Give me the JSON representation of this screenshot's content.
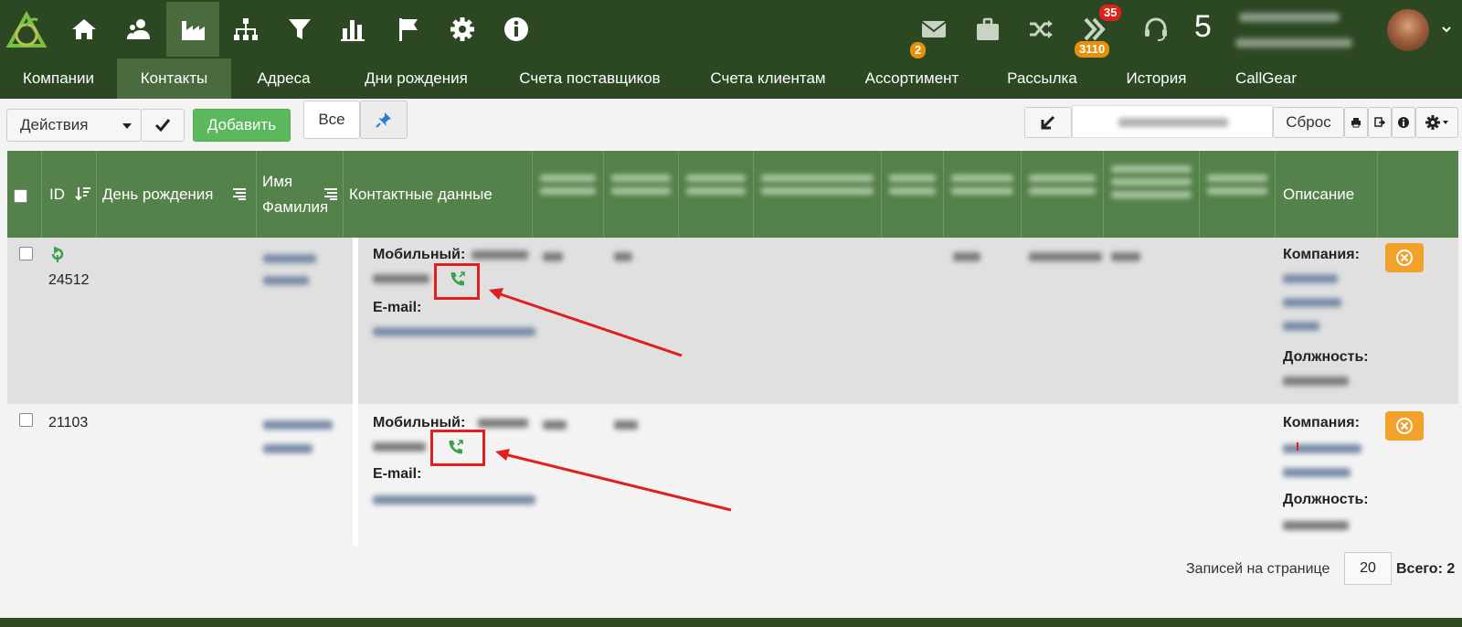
{
  "topbar": {
    "icons": [
      "home-icon",
      "users-icon",
      "factory-icon",
      "org-chart-icon",
      "filter-icon",
      "bar-chart-icon",
      "flag-icon",
      "gear-icon",
      "info-icon"
    ],
    "right_icons": [
      "mail-icon",
      "briefcase-icon",
      "shuffle-icon",
      "chevrons-right-icon",
      "headset-icon"
    ],
    "mail_badge": "2",
    "tasks_badge_red": "35",
    "tasks_badge_orange": "3110",
    "number": "5",
    "colors": {
      "bar": "#2c4823",
      "active": "#4a6b3d",
      "badge_orange": "#e8900c",
      "badge_red": "#d9231b"
    }
  },
  "nav": {
    "items": [
      "Компании",
      "Контакты",
      "Адреса",
      "Дни рождения",
      "Счета поставщиков",
      "Счета клиентам",
      "Ассортимент",
      "Рассылка",
      "История",
      "CallGear"
    ],
    "active": "Контакты"
  },
  "toolbar": {
    "actions_label": "Действия",
    "add_label": "Добавить",
    "all_label": "Все",
    "reset_label": "Сброс"
  },
  "table": {
    "headers": {
      "id": "ID",
      "birthday": "День рождения",
      "name_line1": "Имя",
      "name_line2": "Фамилия",
      "contacts": "Контактные данные",
      "description": "Описание"
    },
    "rows": [
      {
        "id": "24512",
        "mobile_label": "Мобильный:",
        "email_label": "E-mail:",
        "company_label": "Компания:",
        "position_label": "Должность:"
      },
      {
        "id": "21103",
        "mobile_label": "Мобильный:",
        "email_label": "E-mail:",
        "company_label": "Компания:",
        "position_label": "Должность:"
      }
    ]
  },
  "footer": {
    "per_page_label": "Записей на странице",
    "per_page_value": "20",
    "total_label": "Всего: 2"
  }
}
